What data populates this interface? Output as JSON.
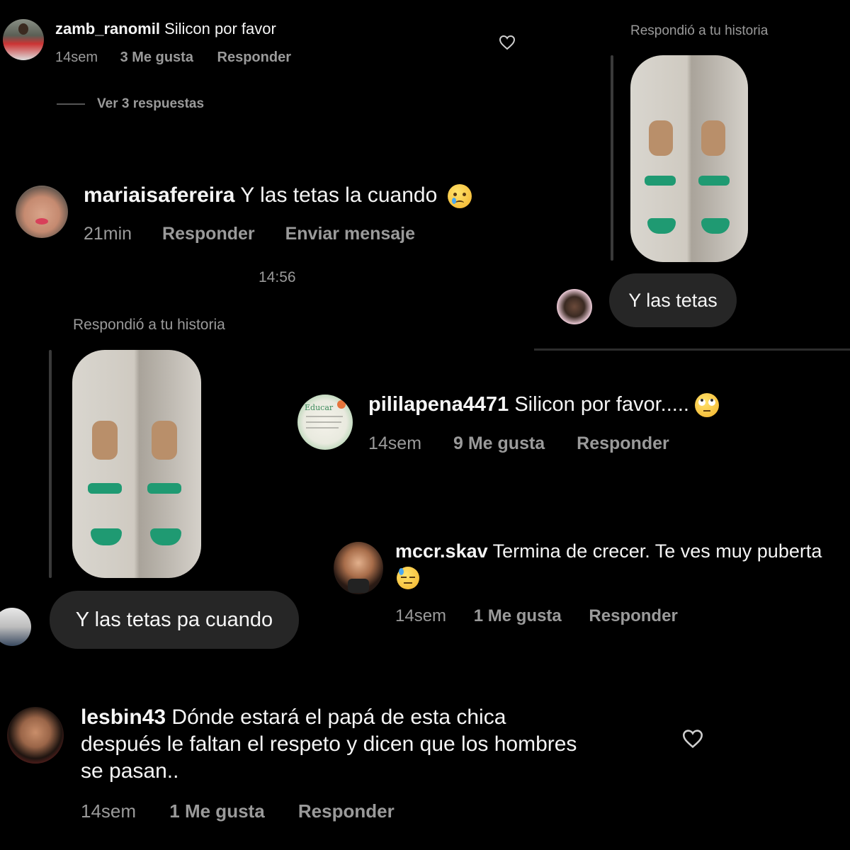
{
  "comment1": {
    "username": "zamb_ranomil",
    "text": "Silicon por favor",
    "time": "14sem",
    "likes": "3 Me gusta",
    "reply": "Responder",
    "view_replies": "Ver 3 respuestas"
  },
  "comment2": {
    "username": "mariaisafereira",
    "text": "Y las tetas la cuando",
    "emoji": "crying-face",
    "time": "21min",
    "reply": "Responder",
    "send_message": "Enviar mensaje"
  },
  "dm_right": {
    "story_label": "Respondió a tu historia",
    "message": "Y las tetas"
  },
  "dm_left": {
    "timestamp": "14:56",
    "story_label": "Respondió a tu historia",
    "message": "Y las tetas pa cuando"
  },
  "comment3": {
    "username": "pililapena4471",
    "text": "Silicon por favor.....",
    "emoji": "eye-roll-face",
    "time": "14sem",
    "likes": "9 Me gusta",
    "reply": "Responder",
    "avatar_text": "Educar"
  },
  "comment4": {
    "username": "mccr.skav",
    "text": "Termina de crecer. Te ves muy puberta",
    "emoji": "downcast-sweat-face",
    "time": "14sem",
    "likes": "1 Me gusta",
    "reply": "Responder"
  },
  "comment5": {
    "username": "lesbin43",
    "text": "Dónde estará el papá de esta chica",
    "text_line2": "después le faltan el respeto y dicen que los hombres",
    "text_line3": "se pasan..",
    "time": "14sem",
    "likes": "1 Me gusta",
    "reply": "Responder"
  },
  "colors": {
    "background": "#000000",
    "bubble": "#262626",
    "meta": "#9a9a9a",
    "text": "#f5f5f5"
  }
}
